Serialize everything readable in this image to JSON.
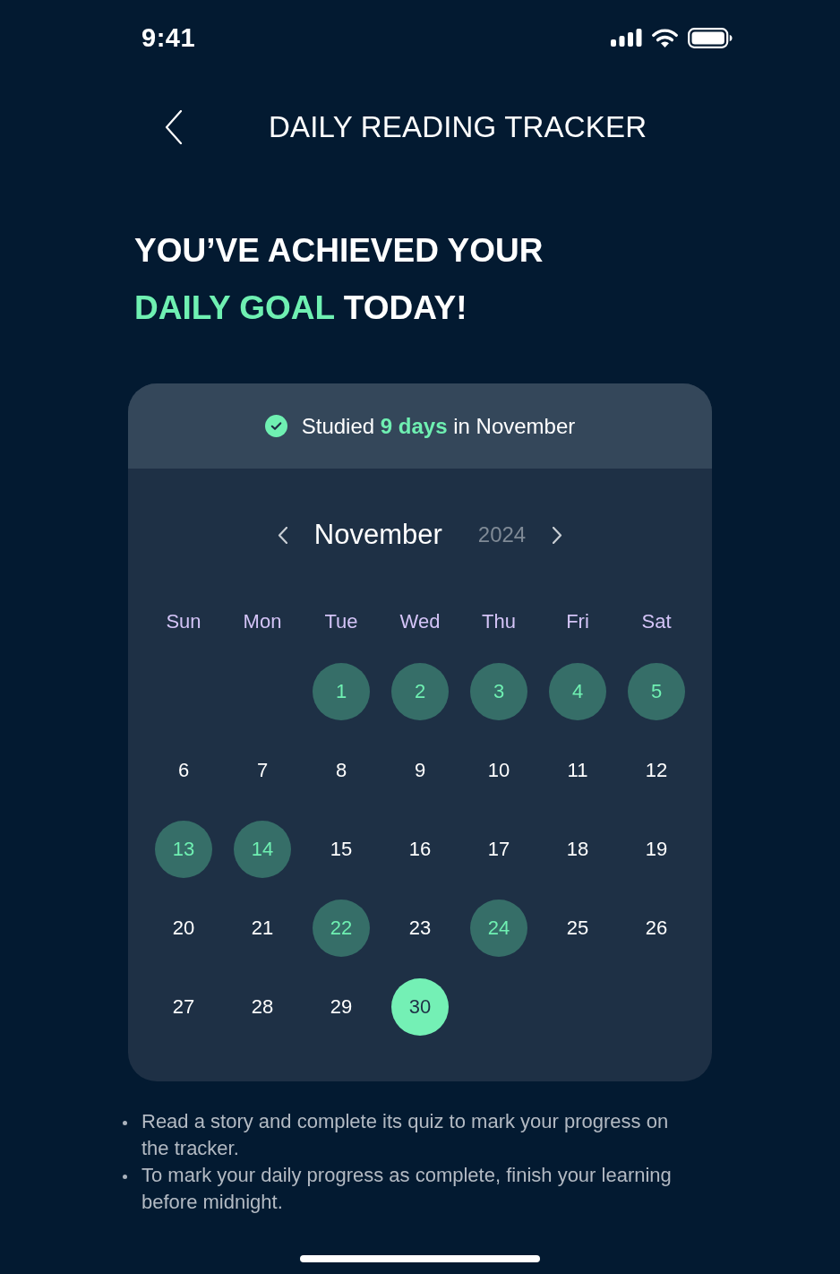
{
  "status_bar": {
    "time": "9:41"
  },
  "header": {
    "title": "DAILY READING TRACKER"
  },
  "headline": "YOU’VE ACHIEVED YOUR **DAILY GOAL** TODAY!",
  "calendar": {
    "summary": "Studied **9 days** in November",
    "month": "November",
    "year": "2024",
    "weekdays": [
      "Sun",
      "Mon",
      "Tue",
      "Wed",
      "Thu",
      "Fri",
      "Sat"
    ],
    "weeks": [
      {
        "days": [
          {
            "label": "1",
            "studied": true,
            "today": false
          },
          {
            "label": "2",
            "studied": true,
            "today": false
          },
          {
            "label": "3",
            "studied": true,
            "today": false
          },
          {
            "label": "4",
            "studied": true,
            "today": false
          },
          {
            "label": "5",
            "studied": true,
            "today": false
          }
        ]
      },
      {
        "days": [
          {
            "label": "6",
            "studied": false,
            "today": false
          },
          {
            "label": "7",
            "studied": false,
            "today": false
          },
          {
            "label": "8",
            "studied": false,
            "today": false
          },
          {
            "label": "9",
            "studied": false,
            "today": false
          },
          {
            "label": "10",
            "studied": false,
            "today": false
          },
          {
            "label": "11",
            "studied": false,
            "today": false
          },
          {
            "label": "12",
            "studied": false,
            "today": false
          }
        ]
      },
      {
        "days": [
          {
            "label": "13",
            "studied": true,
            "today": false
          },
          {
            "label": "14",
            "studied": true,
            "today": false
          },
          {
            "label": "15",
            "studied": false,
            "today": false
          },
          {
            "label": "16",
            "studied": false,
            "today": false
          },
          {
            "label": "17",
            "studied": false,
            "today": false
          },
          {
            "label": "18",
            "studied": false,
            "today": false
          },
          {
            "label": "19",
            "studied": false,
            "today": false
          }
        ]
      },
      {
        "days": [
          {
            "label": "20",
            "studied": false,
            "today": false
          },
          {
            "label": "21",
            "studied": false,
            "today": false
          },
          {
            "label": "22",
            "studied": true,
            "today": false
          },
          {
            "label": "23",
            "studied": false,
            "today": false
          },
          {
            "label": "24",
            "studied": true,
            "today": false
          },
          {
            "label": "25",
            "studied": false,
            "today": false
          },
          {
            "label": "26",
            "studied": false,
            "today": false
          }
        ]
      },
      {
        "days": [
          {
            "label": "27",
            "studied": false,
            "today": false
          },
          {
            "label": "28",
            "studied": false,
            "today": false
          },
          {
            "label": "29",
            "studied": false,
            "today": false
          },
          {
            "label": "30",
            "studied": false,
            "today": true
          }
        ]
      }
    ]
  },
  "notes": [
    "Read a story and complete its quiz to mark your progress on the tracker.",
    "To mark your daily progress as complete, finish your learning before midnight."
  ]
}
